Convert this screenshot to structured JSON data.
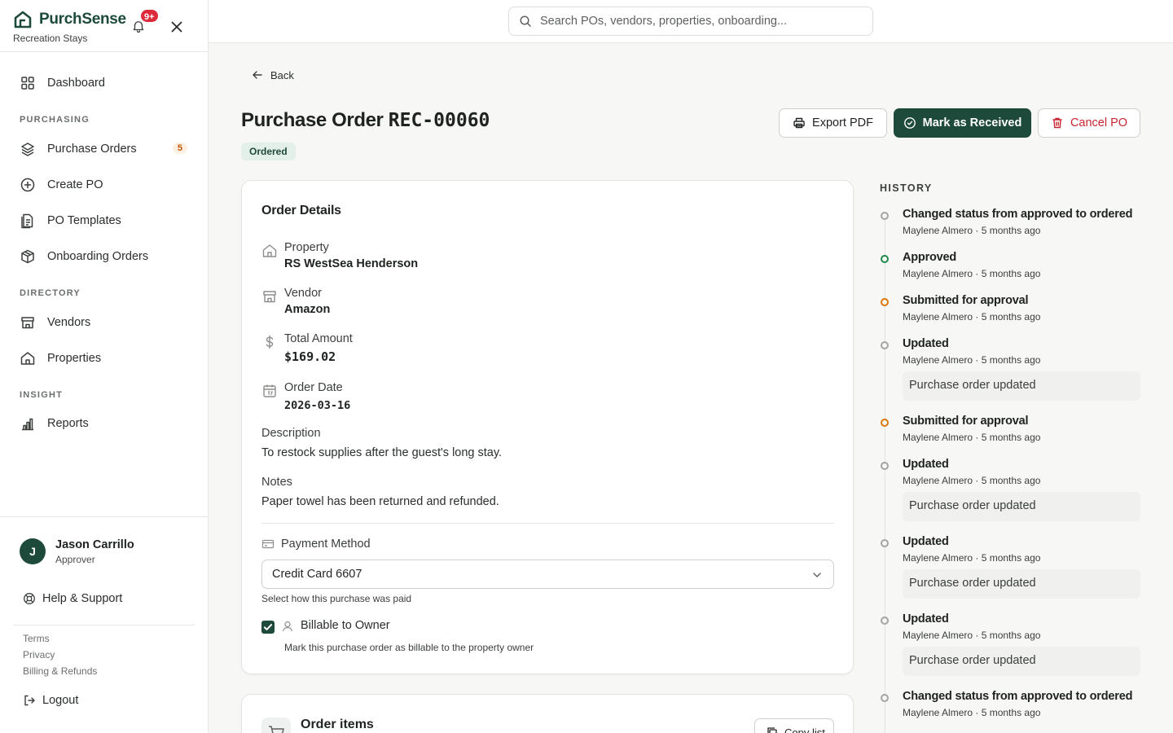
{
  "brand": {
    "name": "PurchSense",
    "subtitle": "Recreation Stays",
    "notifications": "9+"
  },
  "search": {
    "placeholder": "Search POs, vendors, properties, onboarding..."
  },
  "nav": {
    "dashboard": "Dashboard",
    "sections": {
      "purchasing": "PURCHASING",
      "directory": "DIRECTORY",
      "insight": "INSIGHT"
    },
    "purchase_orders": "Purchase Orders",
    "purchase_orders_count": "5",
    "create_po": "Create PO",
    "po_templates": "PO Templates",
    "onboarding_orders": "Onboarding Orders",
    "vendors": "Vendors",
    "properties": "Properties",
    "reports": "Reports"
  },
  "user": {
    "initial": "J",
    "name": "Jason Carrillo",
    "role": "Approver"
  },
  "footer": {
    "help": "Help & Support",
    "terms": "Terms",
    "privacy": "Privacy",
    "billing": "Billing & Refunds",
    "logout": "Logout"
  },
  "page": {
    "back": "Back",
    "title_prefix": "Purchase Order",
    "po_number": "REC-00060",
    "status": "Ordered",
    "actions": {
      "export": "Export PDF",
      "received": "Mark as Received",
      "cancel": "Cancel PO"
    }
  },
  "details": {
    "title": "Order Details",
    "property_label": "Property",
    "property_value": "RS WestSea Henderson",
    "vendor_label": "Vendor",
    "vendor_value": "Amazon",
    "total_label": "Total Amount",
    "total_value": "$169.02",
    "date_label": "Order Date",
    "date_value": "2026-03-16",
    "description_label": "Description",
    "description_value": "To restock supplies after the guest's long stay.",
    "notes_label": "Notes",
    "notes_value": "Paper towel has been returned and refunded.",
    "payment_label": "Payment Method",
    "payment_value": "Credit Card 6607",
    "payment_help": "Select how this purchase was paid",
    "billable_label": "Billable to Owner",
    "billable_checked": true,
    "billable_help": "Mark this purchase order as billable to the property owner"
  },
  "items": {
    "title": "Order items",
    "copy": "Copy list"
  },
  "history": {
    "label": "HISTORY",
    "entries": [
      {
        "title": "Changed status from approved to ordered",
        "meta": "Maylene Almero · 5 months ago",
        "dot": "gray"
      },
      {
        "title": "Approved",
        "meta": "Maylene Almero · 5 months ago",
        "dot": "green"
      },
      {
        "title": "Submitted for approval",
        "meta": "Maylene Almero · 5 months ago",
        "dot": "orange"
      },
      {
        "title": "Updated",
        "meta": "Maylene Almero · 5 months ago",
        "note": "Purchase order updated",
        "dot": "gray"
      },
      {
        "title": "Submitted for approval",
        "meta": "Maylene Almero · 5 months ago",
        "dot": "orange"
      },
      {
        "title": "Updated",
        "meta": "Maylene Almero · 5 months ago",
        "note": "Purchase order updated",
        "dot": "gray"
      },
      {
        "title": "Updated",
        "meta": "Maylene Almero · 5 months ago",
        "note": "Purchase order updated",
        "dot": "gray"
      },
      {
        "title": "Updated",
        "meta": "Maylene Almero · 5 months ago",
        "note": "Purchase order updated",
        "dot": "gray"
      },
      {
        "title": "Changed status from approved to ordered",
        "meta": "Maylene Almero · 5 months ago",
        "dot": "gray"
      }
    ]
  },
  "colors": {
    "brand": "#1e4a3b",
    "danger": "#c8242f",
    "badge": "#dc2b3b",
    "approved": "#1f8a4c",
    "pending": "#d9770a"
  }
}
